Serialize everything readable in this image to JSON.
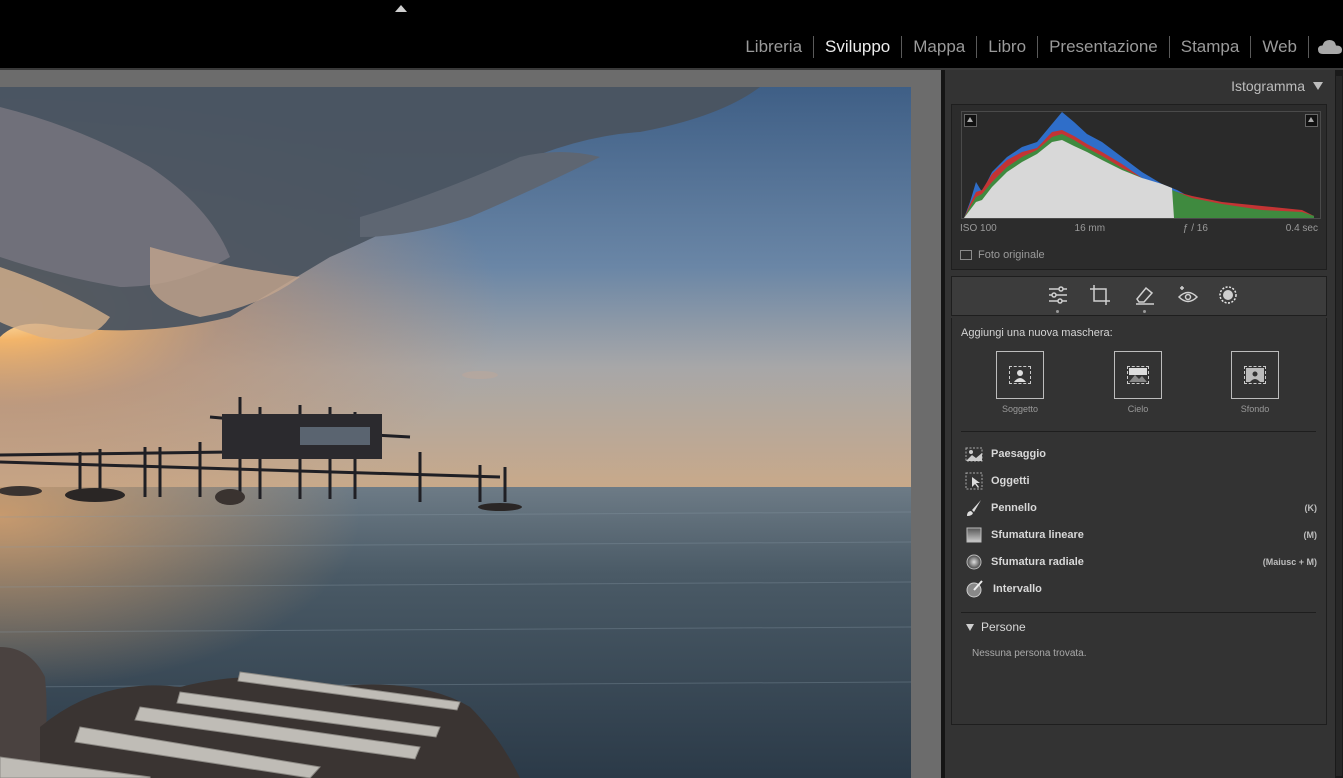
{
  "modules": [
    {
      "label": "Libreria",
      "active": false
    },
    {
      "label": "Sviluppo",
      "active": true
    },
    {
      "label": "Mappa",
      "active": false
    },
    {
      "label": "Libro",
      "active": false
    },
    {
      "label": "Presentazione",
      "active": false
    },
    {
      "label": "Stampa",
      "active": false
    },
    {
      "label": "Web",
      "active": false
    }
  ],
  "histogram": {
    "title": "Istogramma",
    "iso": "ISO 100",
    "focal": "16 mm",
    "aperture": "ƒ / 16",
    "shutter": "0.4 sec",
    "original_label": "Foto originale"
  },
  "tools": [
    "sliders-icon",
    "crop-icon",
    "eraser-icon",
    "red-eye-icon",
    "mask-icon"
  ],
  "masking": {
    "add_label": "Aggiungi una nuova maschera:",
    "quick": [
      {
        "label": "Soggetto",
        "icon": "subject-icon"
      },
      {
        "label": "Cielo",
        "icon": "sky-icon"
      },
      {
        "label": "Sfondo",
        "icon": "background-icon"
      }
    ],
    "items": [
      {
        "label": "Paesaggio",
        "shortcut": "",
        "icon": "landscape-icon"
      },
      {
        "label": "Oggetti",
        "shortcut": "",
        "icon": "objects-icon"
      },
      {
        "label": "Pennello",
        "shortcut": "(K)",
        "icon": "brush-icon"
      },
      {
        "label": "Sfumatura lineare",
        "shortcut": "(M)",
        "icon": "linear-gradient-icon"
      },
      {
        "label": "Sfumatura radiale",
        "shortcut": "(Maiusc + M)",
        "icon": "radial-gradient-icon"
      },
      {
        "label": "Intervallo",
        "shortcut": "",
        "icon": "range-icon"
      }
    ],
    "people_label": "Persone",
    "people_empty": "Nessuna persona trovata."
  },
  "colors": {
    "panel": "#333333",
    "background": "#000000",
    "viewer": "#6c6c6c"
  }
}
